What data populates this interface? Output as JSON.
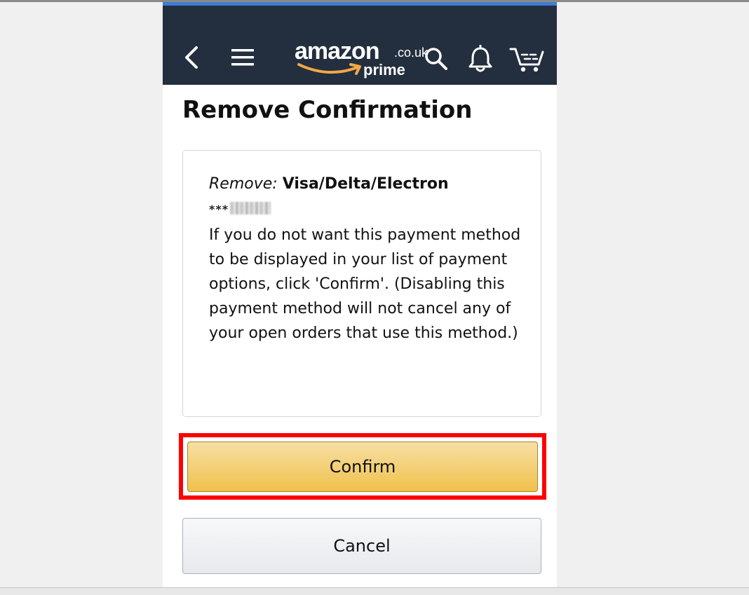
{
  "header": {
    "logo_word": "amazon",
    "logo_tld": ".co.uk",
    "logo_sub": "prime"
  },
  "icons": {
    "back": "back-chevron-icon",
    "menu": "hamburger-menu-icon",
    "search": "search-icon",
    "notifications": "bell-icon",
    "cart": "cart-icon"
  },
  "page": {
    "title": "Remove Confirmation"
  },
  "card": {
    "remove_label": "Remove:",
    "remove_method": "Visa/Delta/Electron",
    "masked_number": "***",
    "description": "If you do not want this payment method to be displayed in your list of payment options, click 'Confirm'. (Disabling this payment method will not cancel any of your open orders that use this method.)"
  },
  "buttons": {
    "confirm": "Confirm",
    "cancel": "Cancel"
  },
  "colors": {
    "navbar": "#232f3e",
    "accent_smile": "#f3a847",
    "confirm_button": "#f0c14b",
    "highlight_box": "#ff0000",
    "top_strip": "#3b7ed3"
  }
}
